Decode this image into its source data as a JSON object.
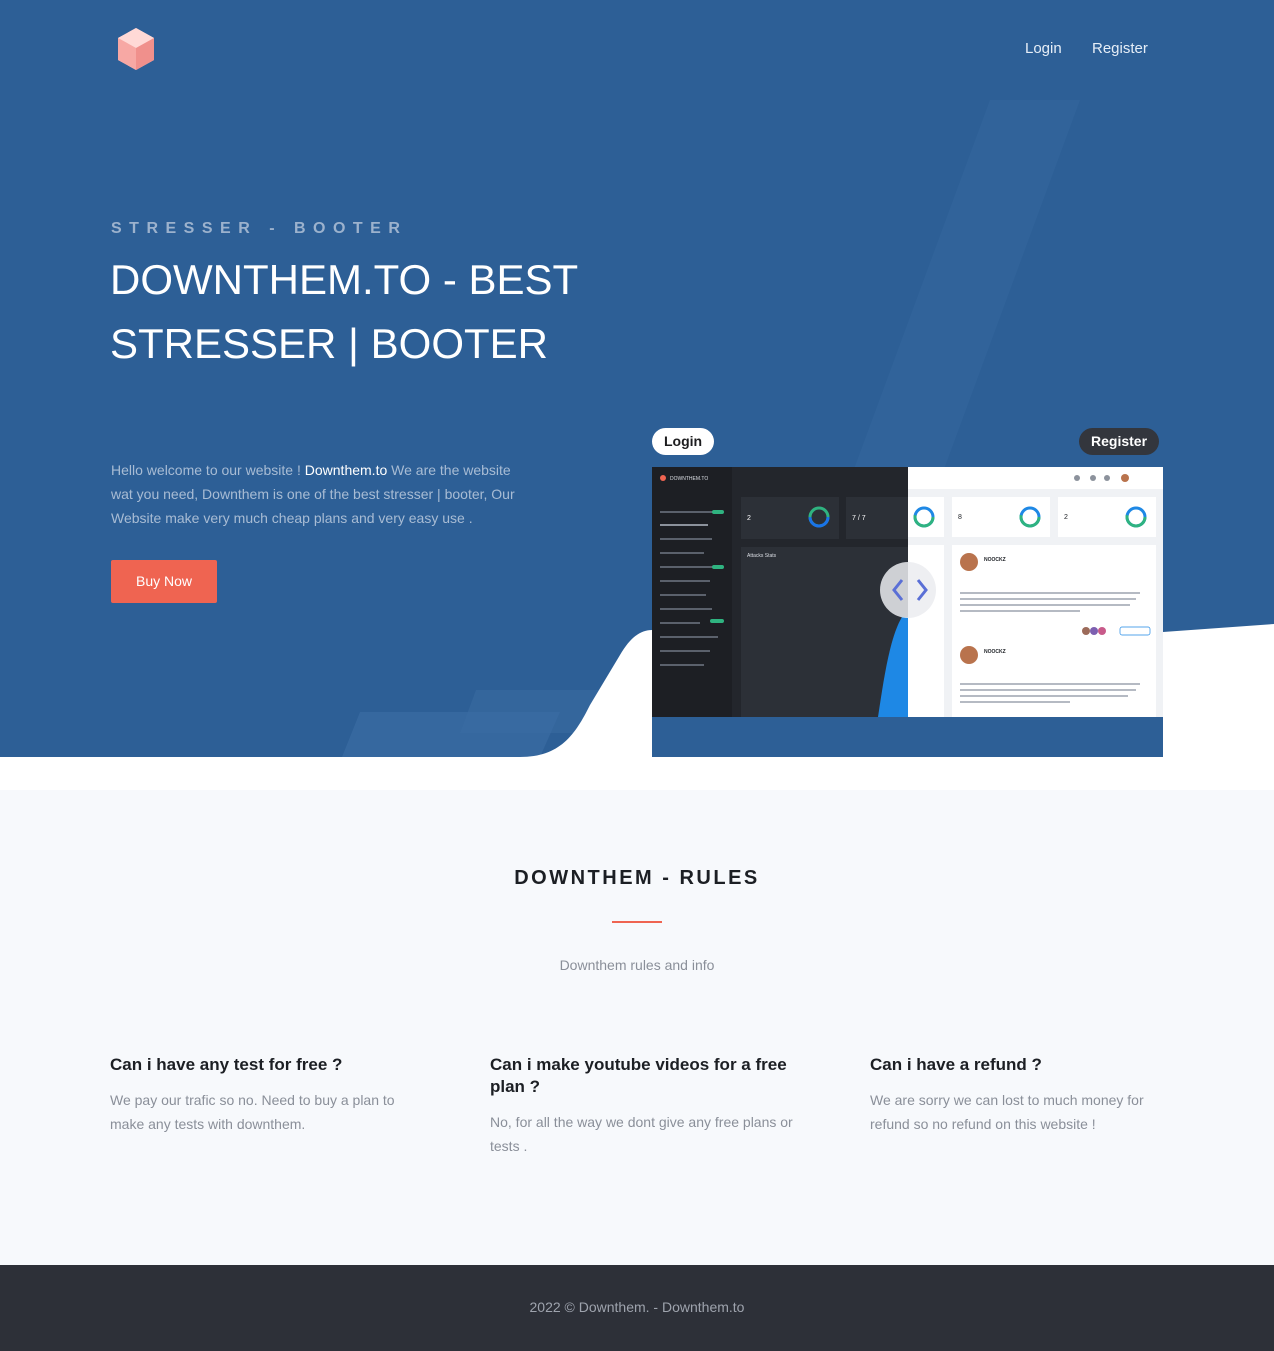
{
  "colors": {
    "hero_bg": "#2d5f96",
    "accent": "#ef6451",
    "footer_bg": "#2d3038",
    "section_bg": "#f7f9fc"
  },
  "header": {
    "logo_icon": "cube-icon",
    "nav": [
      {
        "label": "Login"
      },
      {
        "label": "Register"
      }
    ]
  },
  "hero": {
    "eyebrow": "STRESSER - BOOTER",
    "title": "DOWNTHEM.TO - BEST STRESSER | BOOTER",
    "text_before": "Hello welcome to our website ! ",
    "text_highlight": "Downthem.to",
    "text_after": " We are the website wat you need, Downthem is one of the best stresser | booter, Our Website make very much cheap plans and very easy use .",
    "cta": "Buy Now"
  },
  "preview": {
    "left_label": "Login",
    "right_label": "Register",
    "dark_brand": "DOWNTHEM.TO",
    "dark_stat_values": [
      "2",
      "7 / 7"
    ],
    "dark_chart_title": "Attacks Stats",
    "light_stat_values": [
      "8",
      "2"
    ],
    "post_authors": [
      "NOOCKZ",
      "NOOCKZ"
    ]
  },
  "rules": {
    "title": "DOWNTHEM - RULES",
    "subtitle": "Downthem rules and info",
    "items": [
      {
        "question": "Can i have any test for free ?",
        "answer": "We pay our trafic so no. Need to buy a plan to make any tests with downthem."
      },
      {
        "question": "Can i make youtube videos for a free plan ?",
        "answer": "No, for all the way we dont give any free plans or tests ."
      },
      {
        "question": "Can i have a refund ?",
        "answer": "We are sorry we can lost to much money for refund so no refund on this website !"
      }
    ]
  },
  "footer": {
    "text": "2022 © Downthem. - Downthem.to"
  }
}
